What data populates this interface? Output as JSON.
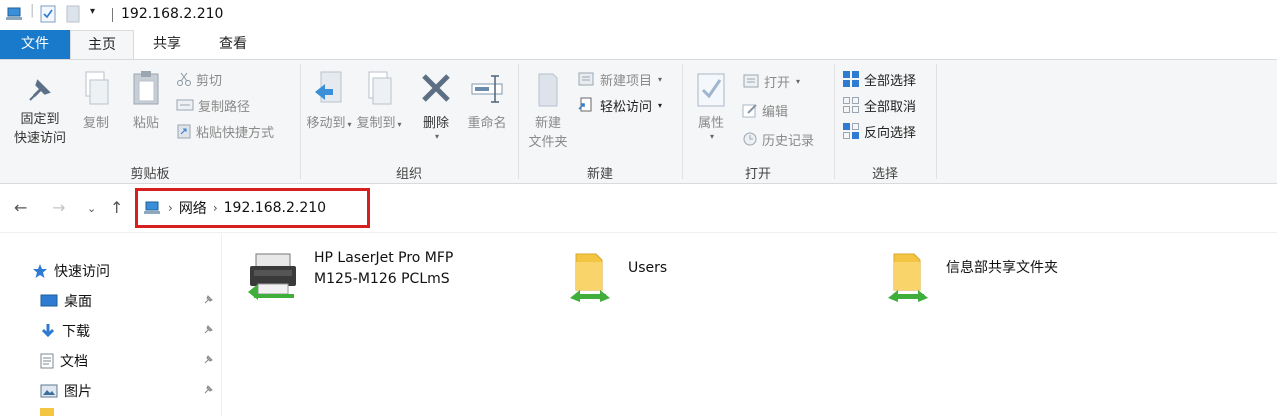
{
  "window": {
    "title": "192.168.2.210"
  },
  "tabs": {
    "file": "文件",
    "home": "主页",
    "share": "共享",
    "view": "查看"
  },
  "ribbon": {
    "clipboard": {
      "label": "剪贴板",
      "pin": "固定到\n快速访问",
      "pin_line1": "固定到",
      "pin_line2": "快速访问",
      "copy": "复制",
      "paste": "粘贴",
      "cut": "剪切",
      "copy_path": "复制路径",
      "paste_shortcut": "粘贴快捷方式"
    },
    "organize": {
      "label": "组织",
      "move_to": "移动到",
      "copy_to": "复制到",
      "delete": "删除",
      "rename": "重命名"
    },
    "new": {
      "label": "新建",
      "new_folder_line1": "新建",
      "new_folder_line2": "文件夹",
      "new_item": "新建项目",
      "easy_access": "轻松访问"
    },
    "open": {
      "label": "打开",
      "properties": "属性",
      "open": "打开",
      "edit": "编辑",
      "history": "历史记录"
    },
    "select": {
      "label": "选择",
      "select_all": "全部选择",
      "select_none": "全部取消",
      "invert": "反向选择"
    }
  },
  "address": {
    "root": "网络",
    "path": "192.168.2.210"
  },
  "sidebar": {
    "items": [
      {
        "label": "快速访问",
        "icon": "star-icon"
      },
      {
        "label": "桌面",
        "icon": "desktop-icon",
        "pinned": true
      },
      {
        "label": "下载",
        "icon": "download-icon",
        "pinned": true
      },
      {
        "label": "文档",
        "icon": "document-icon",
        "pinned": true
      },
      {
        "label": "图片",
        "icon": "pictures-icon",
        "pinned": true
      }
    ]
  },
  "content": {
    "items": [
      {
        "line1": "HP LaserJet Pro MFP",
        "line2": "M125-M126 PCLmS",
        "icon": "printer-icon"
      },
      {
        "line1": "Users",
        "icon": "shared-folder-icon"
      },
      {
        "line1": "信息部共享文件夹",
        "icon": "shared-folder-icon"
      }
    ]
  },
  "colors": {
    "file_tab": "#1979ca",
    "highlight_box": "#d71f1f",
    "ribbon_bg": "#f5f6f7",
    "folder": "#f4c542",
    "share_green": "#3fae3a"
  }
}
